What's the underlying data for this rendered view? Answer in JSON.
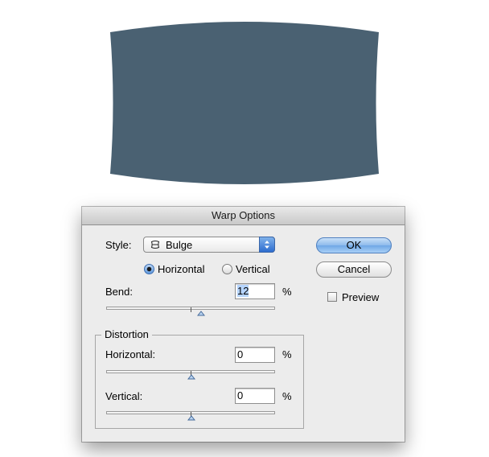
{
  "canvas": {
    "warped_shape_color": "#4a6172"
  },
  "dialog": {
    "title": "Warp Options",
    "style_label": "Style:",
    "style_value": "Bulge",
    "style_icon": "bulge-shape-icon",
    "orientation": {
      "horizontal_label": "Horizontal",
      "vertical_label": "Vertical",
      "selected": "Horizontal"
    },
    "bend": {
      "label": "Bend:",
      "value": "12",
      "unit": "%",
      "slider_percent": 12
    },
    "distortion": {
      "group_label": "Distortion",
      "horizontal": {
        "label": "Horizontal:",
        "value": "0",
        "unit": "%",
        "slider_percent": 0
      },
      "vertical": {
        "label": "Vertical:",
        "value": "0",
        "unit": "%",
        "slider_percent": 0
      }
    },
    "buttons": {
      "ok": "OK",
      "cancel": "Cancel"
    },
    "preview": {
      "label": "Preview",
      "checked": false
    }
  }
}
